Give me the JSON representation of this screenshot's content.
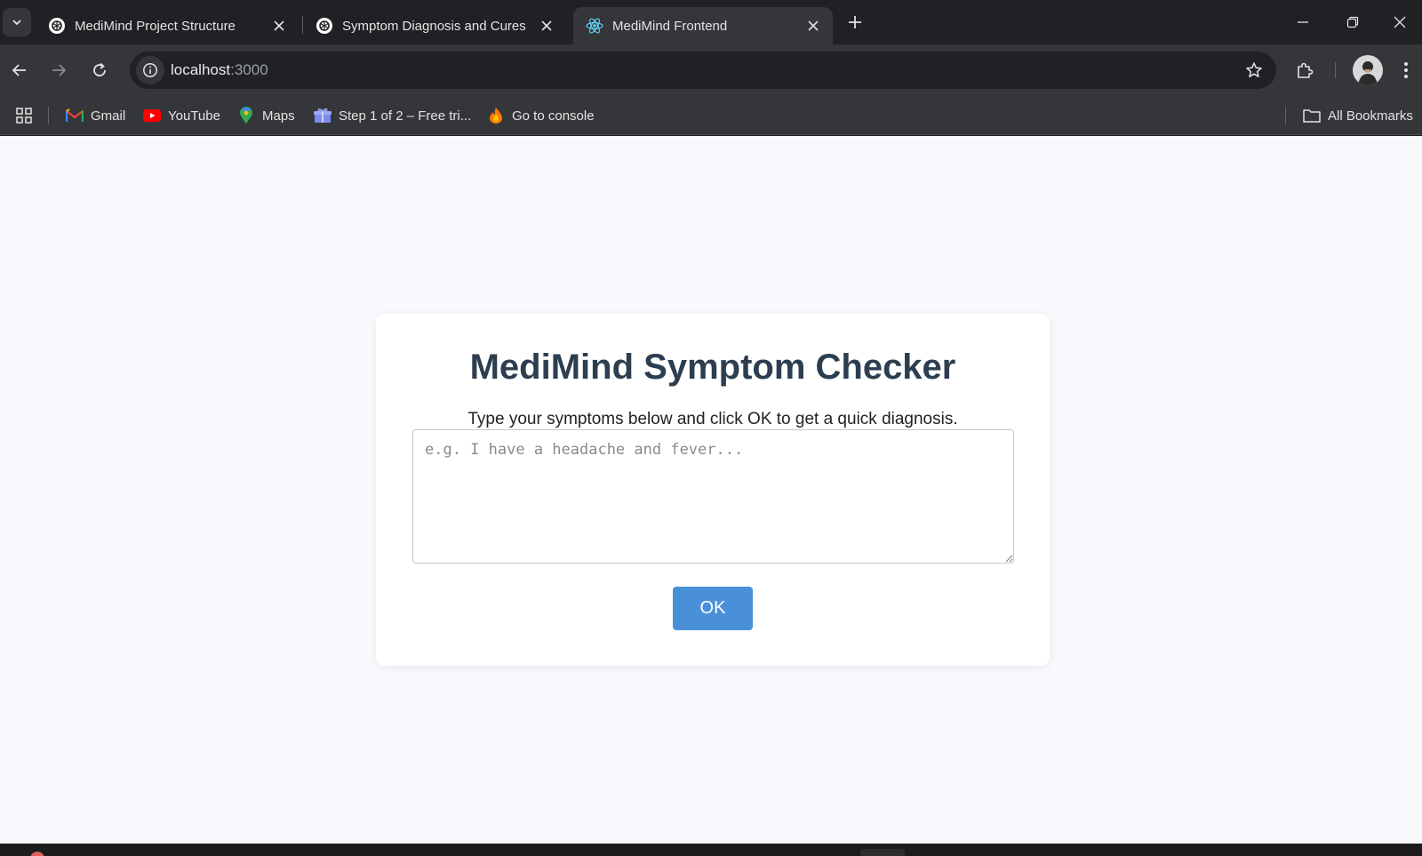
{
  "browser": {
    "tabs": [
      {
        "title": "MediMind Project Structure",
        "icon": "openai-icon",
        "active": false
      },
      {
        "title": "Symptom Diagnosis and Cures",
        "icon": "openai-icon",
        "active": false
      },
      {
        "title": "MediMind Frontend",
        "icon": "react-icon",
        "active": true
      }
    ],
    "url_host": "localhost",
    "url_port": ":3000",
    "bookmarks": [
      {
        "label": "Gmail",
        "icon": "gmail-icon"
      },
      {
        "label": "YouTube",
        "icon": "youtube-icon"
      },
      {
        "label": "Maps",
        "icon": "maps-icon"
      },
      {
        "label": "Step 1 of 2 – Free tri...",
        "icon": "gift-icon"
      },
      {
        "label": "Go to console",
        "icon": "firebase-icon"
      }
    ],
    "all_bookmarks_label": "All Bookmarks"
  },
  "page": {
    "title": "MediMind Symptom Checker",
    "subtitle": "Type your symptoms below and click OK to get a quick diagnosis.",
    "symptoms_input": {
      "value": "",
      "placeholder": "e.g. I have a headache and fever..."
    },
    "ok_label": "OK"
  },
  "colors": {
    "accent": "#4a90d9",
    "heading": "#2c3e50",
    "page_background": "#f8f9fc"
  }
}
